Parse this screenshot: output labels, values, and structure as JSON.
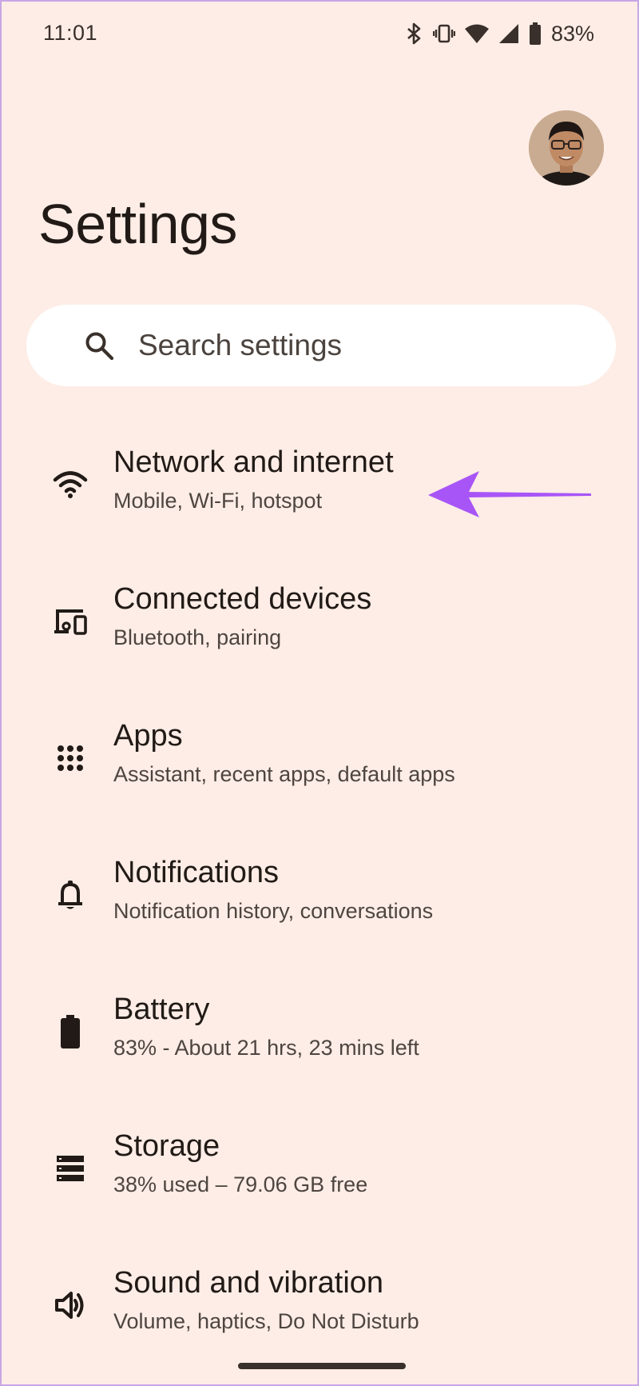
{
  "status_bar": {
    "time": "11:01",
    "battery_percent": "83%",
    "icons": [
      "bluetooth-icon",
      "vibrate-icon",
      "wifi-icon",
      "cell-signal-icon",
      "battery-icon"
    ]
  },
  "header": {
    "title": "Settings"
  },
  "search": {
    "placeholder": "Search settings",
    "icon": "search-icon"
  },
  "settings": {
    "items": [
      {
        "title": "Network and internet",
        "subtitle": "Mobile, Wi-Fi, hotspot",
        "icon": "wifi-icon"
      },
      {
        "title": "Connected devices",
        "subtitle": "Bluetooth, pairing",
        "icon": "connected-devices-icon"
      },
      {
        "title": "Apps",
        "subtitle": "Assistant, recent apps, default apps",
        "icon": "apps-grid-icon"
      },
      {
        "title": "Notifications",
        "subtitle": "Notification history, conversations",
        "icon": "bell-icon"
      },
      {
        "title": "Battery",
        "subtitle": "83% - About 21 hrs, 23 mins left",
        "icon": "battery-icon"
      },
      {
        "title": "Storage",
        "subtitle": "38% used – 79.06 GB free",
        "icon": "storage-icon"
      },
      {
        "title": "Sound and vibration",
        "subtitle": "Volume, haptics, Do Not Disturb",
        "icon": "speaker-icon"
      }
    ]
  },
  "colors": {
    "background": "#fdede6",
    "search_background": "#ffffff",
    "text_primary": "#211a16",
    "text_secondary": "#4e4540",
    "annotation_arrow": "#a855f7"
  }
}
